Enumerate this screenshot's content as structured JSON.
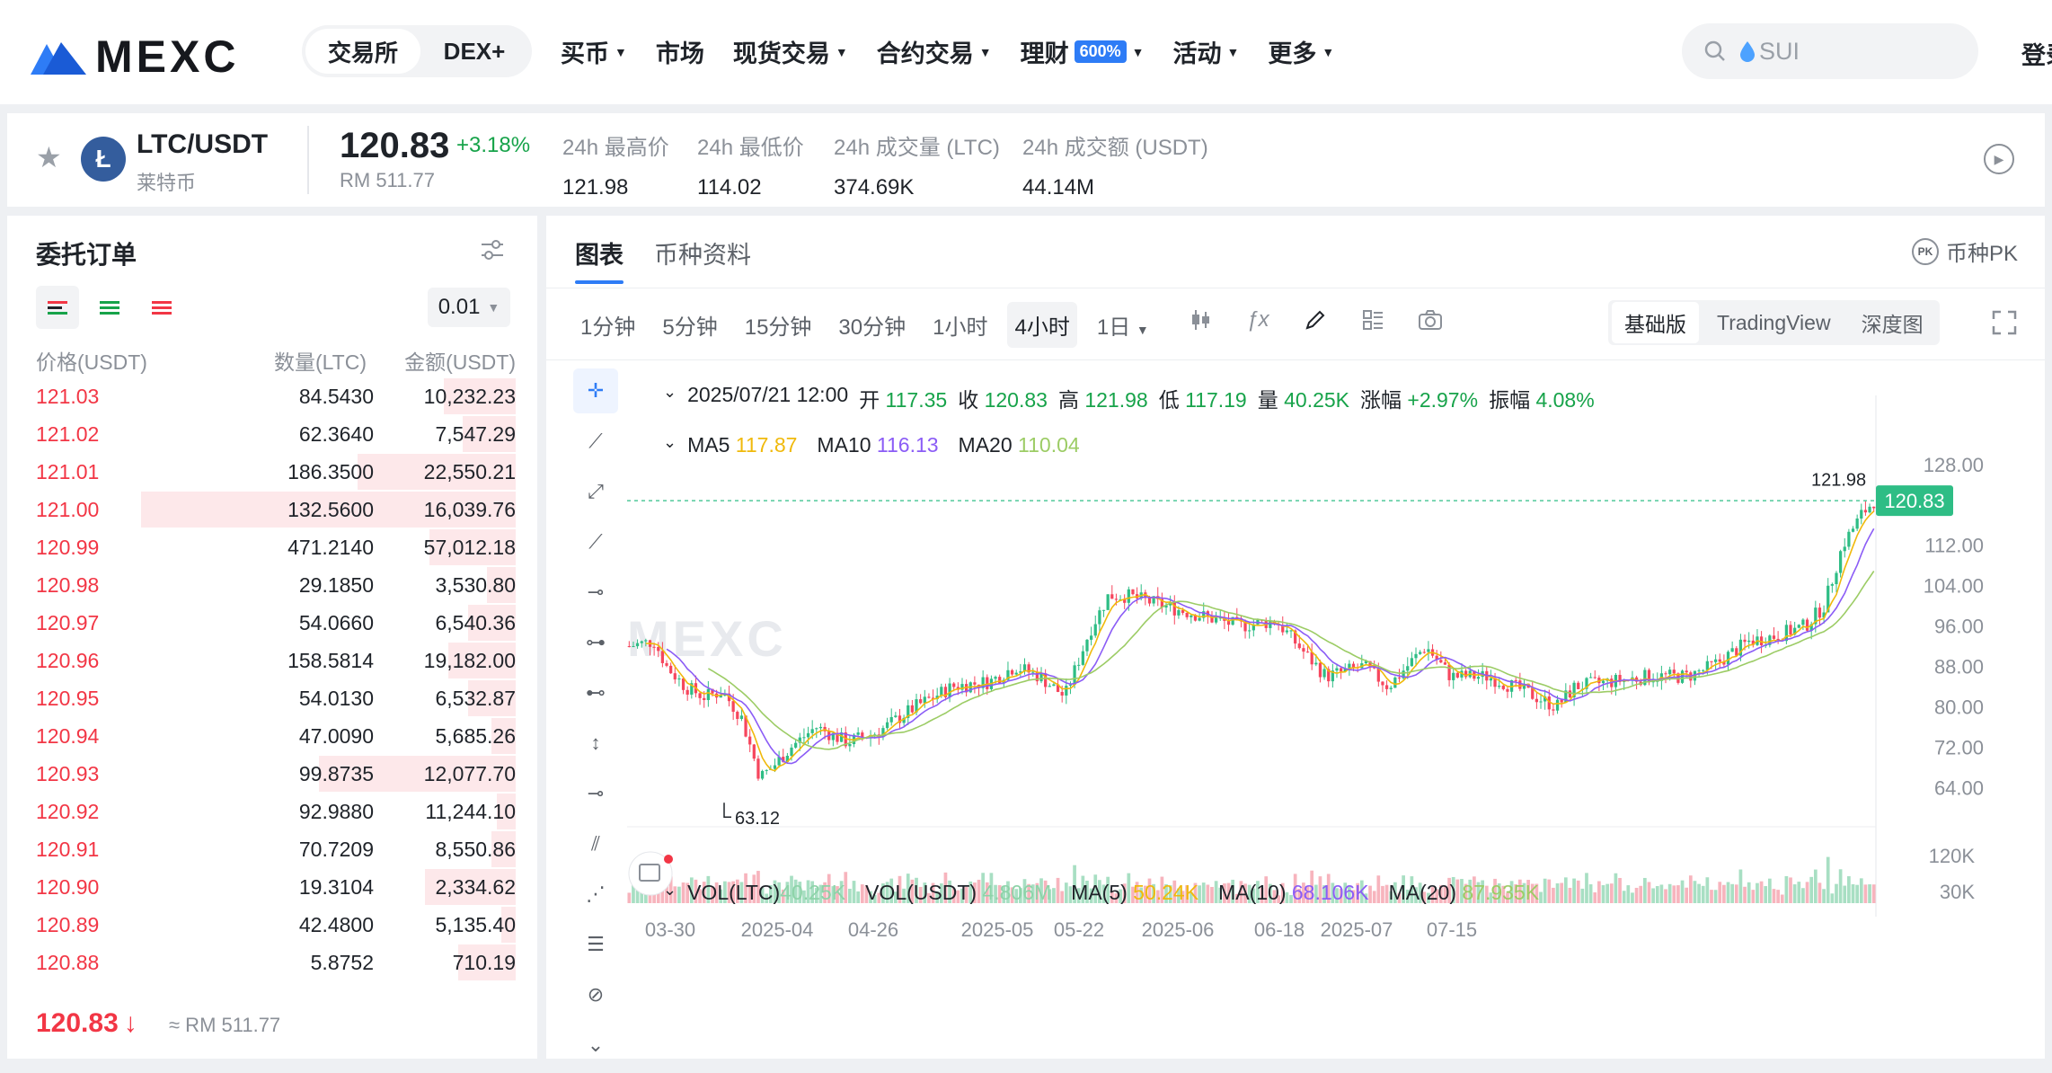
{
  "header": {
    "logo_text": "MEXC",
    "segment": [
      {
        "label": "交易所",
        "active": true
      },
      {
        "label": "DEX+",
        "active": false
      }
    ],
    "nav": [
      {
        "label": "买币",
        "dropdown": true
      },
      {
        "label": "市场",
        "dropdown": false
      },
      {
        "label": "现货交易",
        "dropdown": true
      },
      {
        "label": "合约交易",
        "dropdown": true
      },
      {
        "label": "理财",
        "badge": "600%",
        "dropdown": true
      },
      {
        "label": "活动",
        "dropdown": true
      },
      {
        "label": "更多",
        "dropdown": true
      }
    ],
    "search_placeholder": "SUI",
    "login_label": "登录"
  },
  "ticker": {
    "pair": "LTC/USDT",
    "coin_name": "莱特币",
    "coin_icon_letter": "Ł",
    "price": "120.83",
    "change": "+3.18%",
    "rm_price": "RM 511.77",
    "stats": [
      {
        "label": "24h 最高价",
        "value": "121.98"
      },
      {
        "label": "24h 最低价",
        "value": "114.02"
      },
      {
        "label": "24h 成交量 (LTC)",
        "value": "374.69K"
      },
      {
        "label": "24h 成交额 (USDT)",
        "value": "44.14M"
      }
    ]
  },
  "orderbook": {
    "title": "委托订单",
    "precision": "0.01",
    "headers": {
      "price": "价格(USDT)",
      "qty": "数量(LTC)",
      "amount": "金额(USDT)"
    },
    "asks": [
      {
        "price": "121.03",
        "qty": "84.5430",
        "amount": "10,232.23",
        "depth": 0.15
      },
      {
        "price": "121.02",
        "qty": "62.3640",
        "amount": "7,547.29",
        "depth": 0.11
      },
      {
        "price": "121.01",
        "qty": "186.3500",
        "amount": "22,550.21",
        "depth": 0.33
      },
      {
        "price": "121.00",
        "qty": "132.5600",
        "amount": "16,039.76",
        "depth": 0.78
      },
      {
        "price": "120.99",
        "qty": "471.2140",
        "amount": "57,012.18",
        "depth": 0.18
      },
      {
        "price": "120.98",
        "qty": "29.1850",
        "amount": "3,530.80",
        "depth": 0.06
      },
      {
        "price": "120.97",
        "qty": "54.0660",
        "amount": "6,540.36",
        "depth": 0.1
      },
      {
        "price": "120.96",
        "qty": "158.5814",
        "amount": "19,182.00",
        "depth": 0.14
      },
      {
        "price": "120.95",
        "qty": "54.0130",
        "amount": "6,532.87",
        "depth": 0.1
      },
      {
        "price": "120.94",
        "qty": "47.0090",
        "amount": "5,685.26",
        "depth": 0.05
      },
      {
        "price": "120.93",
        "qty": "99.8735",
        "amount": "12,077.70",
        "depth": 0.41
      },
      {
        "price": "120.92",
        "qty": "92.9880",
        "amount": "11,244.10",
        "depth": 0.04
      },
      {
        "price": "120.91",
        "qty": "70.7209",
        "amount": "8,550.86",
        "depth": 0.05
      },
      {
        "price": "120.90",
        "qty": "19.3104",
        "amount": "2,334.62",
        "depth": 0.19
      },
      {
        "price": "120.89",
        "qty": "42.4800",
        "amount": "5,135.40",
        "depth": 0.03
      },
      {
        "price": "120.88",
        "qty": "5.8752",
        "amount": "710.19",
        "depth": 0.12
      }
    ],
    "last_price": "120.83",
    "last_arrow": "↓",
    "last_rm": "≈ RM 511.77"
  },
  "chart_panel": {
    "tabs": [
      {
        "label": "图表",
        "active": true
      },
      {
        "label": "币种资料",
        "active": false
      }
    ],
    "pk_label": "币种PK",
    "intervals": [
      {
        "label": "1分钟",
        "active": false
      },
      {
        "label": "5分钟",
        "active": false
      },
      {
        "label": "15分钟",
        "active": false
      },
      {
        "label": "30分钟",
        "active": false
      },
      {
        "label": "1小时",
        "active": false
      },
      {
        "label": "4小时",
        "active": true
      },
      {
        "label": "1日",
        "active": false
      }
    ],
    "modes": [
      {
        "label": "基础版",
        "active": true
      },
      {
        "label": "TradingView",
        "active": false
      },
      {
        "label": "深度图",
        "active": false
      }
    ],
    "ohlc": {
      "date": "2025/07/21 12:00",
      "open_label": "开",
      "open": "117.35",
      "close_label": "收",
      "close": "120.83",
      "high_label": "高",
      "high": "121.98",
      "low_label": "低",
      "low": "117.19",
      "vol_label": "量",
      "vol": "40.25K",
      "chg_label": "涨幅",
      "chg": "+2.97%",
      "amp_label": "振幅",
      "amp": "4.08%"
    },
    "ma": [
      {
        "label": "MA5",
        "value": "117.87",
        "color": "#f0b90b"
      },
      {
        "label": "MA10",
        "value": "116.13",
        "color": "#8b5cf6"
      },
      {
        "label": "MA20",
        "value": "110.04",
        "color": "#9ccc65"
      }
    ],
    "vol_legend": [
      {
        "label": "VOL(LTC)",
        "value": "40.25K",
        "color": "#8dd3a8"
      },
      {
        "label": "VOL(USDT)",
        "value": "4.806M",
        "color": "#8dd3a8"
      },
      {
        "label": "MA(5)",
        "value": "50.24K",
        "color": "#f0b90b"
      },
      {
        "label": "MA(10)",
        "value": "68.106K",
        "color": "#8b5cf6"
      },
      {
        "label": "MA(20)",
        "value": "87.935K",
        "color": "#9ccc65"
      }
    ],
    "watermark": "MEXC"
  },
  "chart_data": {
    "type": "candlestick",
    "interval": "4小时",
    "y_ticks": [
      "128.00",
      "112.00",
      "104.00",
      "96.00",
      "88.00",
      "80.00",
      "72.00",
      "64.00"
    ],
    "ylim": [
      58,
      131
    ],
    "x_ticks": [
      "03-30",
      "2025-04",
      "04-26",
      "2025-05",
      "05-22",
      "2025-06",
      "06-18",
      "2025-07",
      "07-15"
    ],
    "high_marker": "121.98",
    "low_marker": "63.12",
    "last_price_label": "120.83",
    "last_price": 120.83,
    "vol_ticks": [
      "120K",
      "30K"
    ],
    "price_path": [
      [
        0,
        92
      ],
      [
        0.02,
        93
      ],
      [
        0.03,
        88
      ],
      [
        0.045,
        84
      ],
      [
        0.06,
        82
      ],
      [
        0.075,
        83
      ],
      [
        0.09,
        78
      ],
      [
        0.105,
        66
      ],
      [
        0.115,
        68
      ],
      [
        0.13,
        72
      ],
      [
        0.15,
        76
      ],
      [
        0.175,
        73
      ],
      [
        0.2,
        75
      ],
      [
        0.23,
        80
      ],
      [
        0.26,
        84
      ],
      [
        0.29,
        85
      ],
      [
        0.31,
        88
      ],
      [
        0.33,
        86
      ],
      [
        0.35,
        82
      ],
      [
        0.37,
        95
      ],
      [
        0.385,
        102
      ],
      [
        0.4,
        102
      ],
      [
        0.43,
        100
      ],
      [
        0.46,
        98
      ],
      [
        0.49,
        96
      ],
      [
        0.52,
        97
      ],
      [
        0.545,
        90
      ],
      [
        0.56,
        86
      ],
      [
        0.59,
        88
      ],
      [
        0.61,
        84
      ],
      [
        0.64,
        92
      ],
      [
        0.66,
        86
      ],
      [
        0.69,
        86
      ],
      [
        0.72,
        83
      ],
      [
        0.745,
        80
      ],
      [
        0.76,
        84
      ],
      [
        0.79,
        85
      ],
      [
        0.82,
        86
      ],
      [
        0.85,
        86
      ],
      [
        0.87,
        88
      ],
      [
        0.9,
        93
      ],
      [
        0.92,
        94
      ],
      [
        0.945,
        96
      ],
      [
        0.96,
        100
      ],
      [
        0.975,
        112
      ],
      [
        0.99,
        118
      ],
      [
        1.0,
        120.8
      ]
    ],
    "colors": {
      "up": "#2ebd85",
      "down": "#f6465d",
      "ma5": "#f0b90b",
      "ma10": "#8b5cf6",
      "ma20": "#9ccc65"
    }
  }
}
